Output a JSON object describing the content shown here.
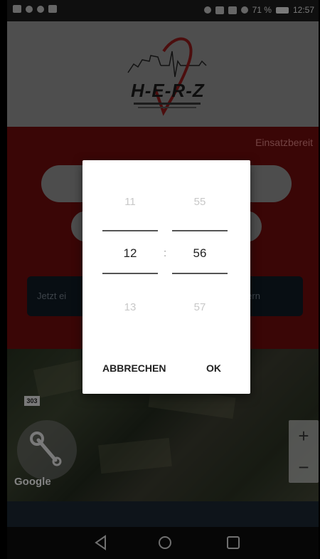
{
  "status_bar": {
    "signal": "71 %",
    "time": "12:57"
  },
  "header": {
    "logo_text": "H-E-R-Z"
  },
  "main": {
    "status_label": "Einsatzbereit",
    "action_button_left": "Jetzt ei",
    "action_button_right": "ern"
  },
  "map": {
    "road_sign": "303",
    "zoom_in": "+",
    "zoom_out": "−",
    "google_label": "Google"
  },
  "time_picker": {
    "hour_prev": "11",
    "hour_selected": "12",
    "hour_next": "13",
    "separator": ":",
    "minute_prev": "55",
    "minute_selected": "56",
    "minute_next": "57",
    "cancel_label": "ABBRECHEN",
    "ok_label": "OK"
  },
  "icons": {
    "settings": "wrench-icon",
    "back": "back-triangle-icon",
    "home": "home-circle-icon",
    "recents": "recents-square-icon"
  }
}
